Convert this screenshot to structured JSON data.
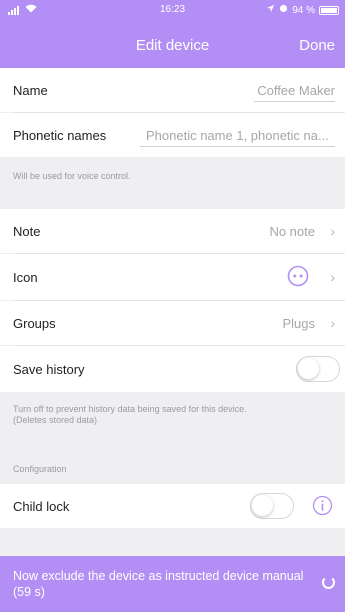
{
  "status_bar": {
    "time": "16:23",
    "battery": "94 %"
  },
  "nav": {
    "title": "Edit device",
    "done_label": "Done"
  },
  "fields": {
    "name_label": "Name",
    "name_value": "Coffee Maker",
    "phonetic_label": "Phonetic names",
    "phonetic_placeholder": "Phonetic name 1, phonetic na...",
    "phonetic_hint": "Will be used for voice control."
  },
  "settings": {
    "note_label": "Note",
    "note_value": "No note",
    "icon_label": "Icon",
    "groups_label": "Groups",
    "groups_value": "Plugs",
    "save_history_label": "Save history",
    "history_hint_line1": "Turn off to prevent history data being saved for this device.",
    "history_hint_line2": "(Deletes stored data)",
    "configuration_header": "Configuration",
    "child_lock_label": "Child lock"
  },
  "bottom": {
    "message": "Now exclude the device as instructed device manual (59 s)"
  },
  "colors": {
    "accent": "#b38ff5",
    "background": "#efeff1"
  }
}
